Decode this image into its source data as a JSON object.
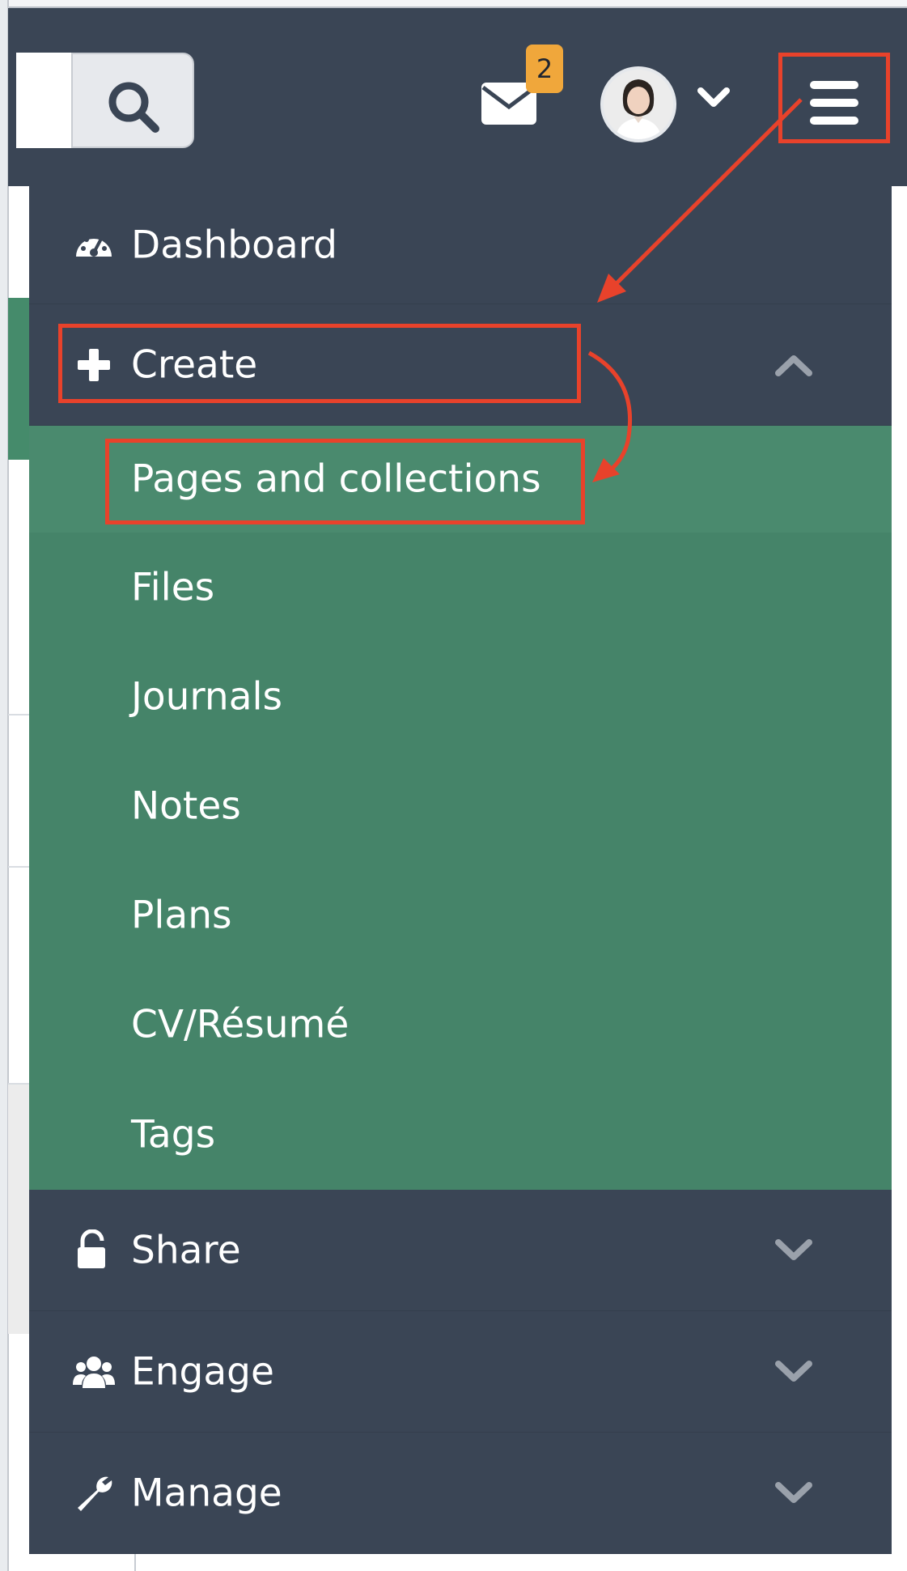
{
  "header": {
    "search_placeholder": "",
    "mail_badge": "2",
    "avatar_alt": "User avatar"
  },
  "menu": {
    "dashboard": "Dashboard",
    "create": "Create",
    "create_subitems": [
      "Pages and collections",
      "Files",
      "Journals",
      "Notes",
      "Plans",
      "CV/Résumé",
      "Tags"
    ],
    "share": "Share",
    "engage": "Engage",
    "manage": "Manage"
  },
  "icons": {
    "search": "search-icon",
    "mail": "envelope-icon",
    "menu": "hamburger-icon",
    "dashboard": "dashboard-gauge-icon",
    "create": "plus-icon",
    "share": "unlock-icon",
    "engage": "users-icon",
    "manage": "wrench-icon"
  },
  "colors": {
    "header_bg": "#3a4555",
    "submenu_bg": "#458469",
    "badge": "#f0a73b",
    "annotation": "#e8422b"
  }
}
